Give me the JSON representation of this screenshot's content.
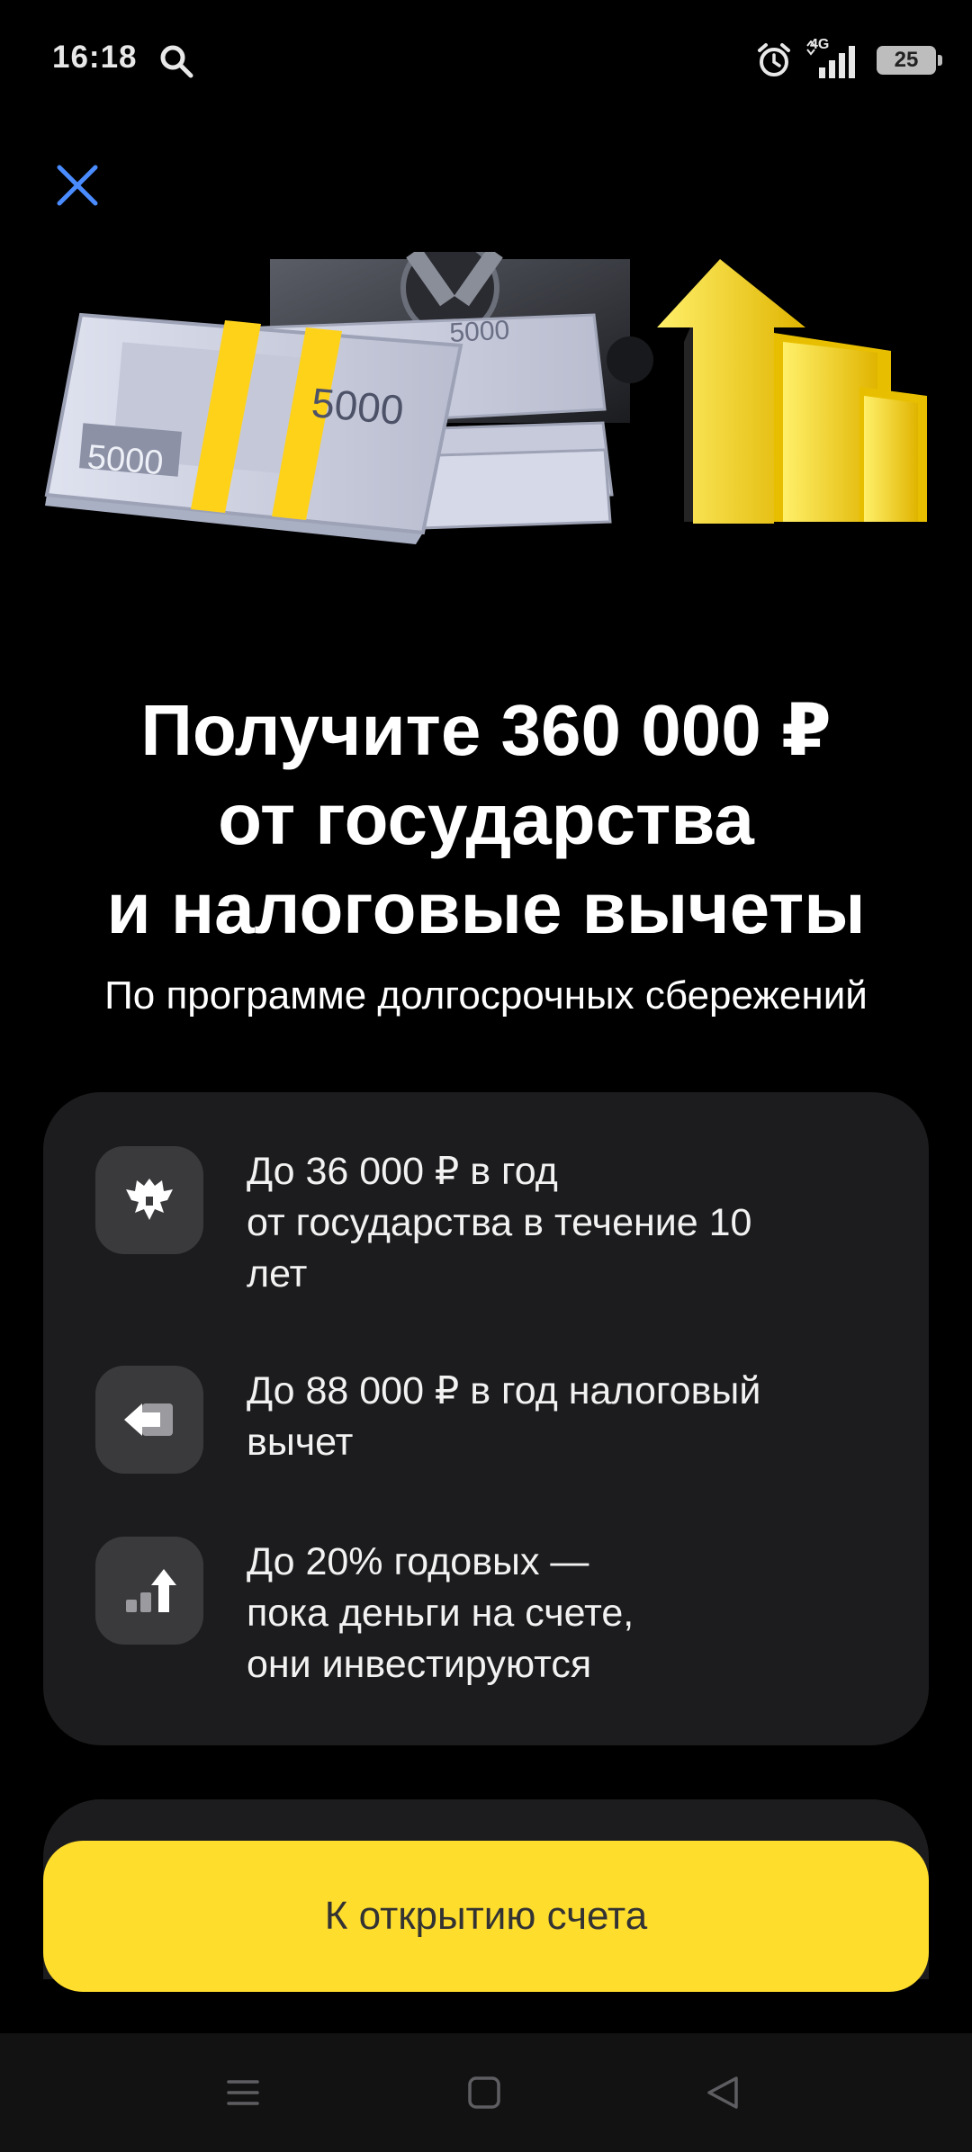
{
  "status_bar": {
    "time": "16:18",
    "network": "4G",
    "battery": "25",
    "icons": [
      "search-icon",
      "alarm-icon",
      "signal-icon",
      "battery-icon"
    ]
  },
  "close_icon": "close-icon",
  "hero": {
    "banknote_labels": [
      "5000",
      "5000",
      "5000",
      "5000"
    ]
  },
  "title_lines": [
    "Получите 360 000 ₽",
    "от государства",
    "и налоговые вычеты"
  ],
  "subtitle": "По программе долгосрочных сбережений",
  "benefits": [
    {
      "icon": "state-emblem-icon",
      "lines": [
        "До 36 000 ₽ в год",
        "от государства в течение 10",
        "лет"
      ]
    },
    {
      "icon": "tax-return-icon",
      "lines": [
        "До 88 000 ₽ в год налоговый",
        "вычет"
      ]
    },
    {
      "icon": "growth-chart-icon",
      "lines": [
        "До 20% годовых —",
        "пока деньги на счете,",
        "они инвестируются"
      ]
    }
  ],
  "cta_label": "К открытию счета",
  "nav_bar": {
    "icons": [
      "menu-icon",
      "home-icon",
      "back-icon"
    ]
  },
  "colors": {
    "background": "#000000",
    "card": "#1c1c1e",
    "icon_tile": "#3a3a3c",
    "accent": "#ffdd2d",
    "close": "#4a8cff"
  }
}
